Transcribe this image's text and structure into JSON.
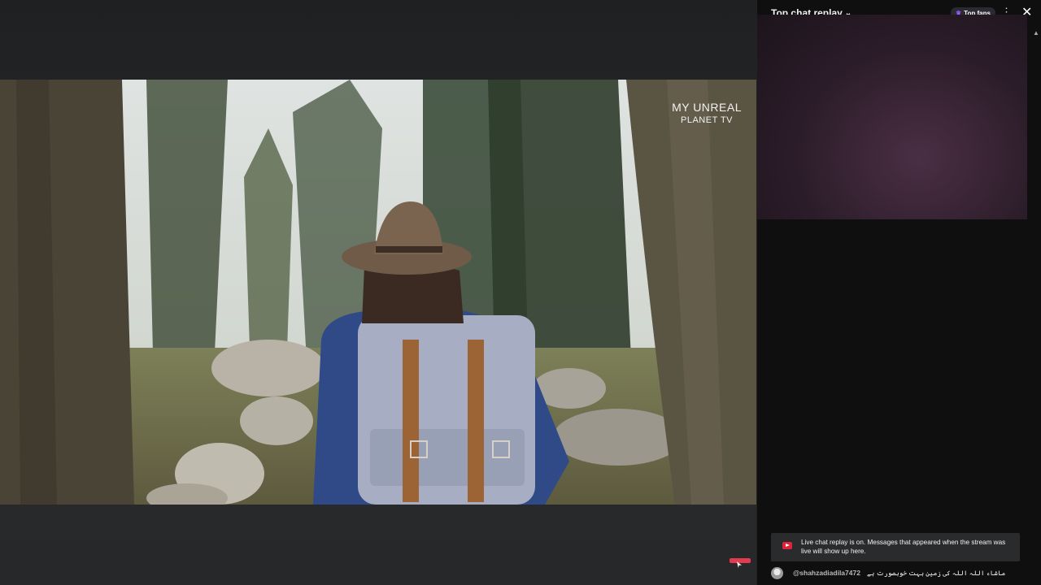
{
  "video": {
    "watermark_line1": "MY UNREAL",
    "watermark_line2": "PLANET TV"
  },
  "chat": {
    "title": "Top chat replay",
    "title_chevron_icon": "chevron-down-icon",
    "top_fans_label": "Top fans",
    "more_icon": "kebab-menu-icon",
    "close_icon": "close-icon",
    "notice_text": "Live chat replay is on. Messages that appeared when the stream was live will show up here.",
    "messages": [
      {
        "author": "@shahzadiadila7472",
        "text": "ماشاء اللہ اللہ کی زمین بہت خوبصورت ہے"
      }
    ]
  },
  "colors": {
    "accent_red": "#e0223a",
    "top_fans_star": "#9b5cff",
    "chat_bg": "#0f0f10",
    "notice_bg": "#2a2b2d"
  }
}
